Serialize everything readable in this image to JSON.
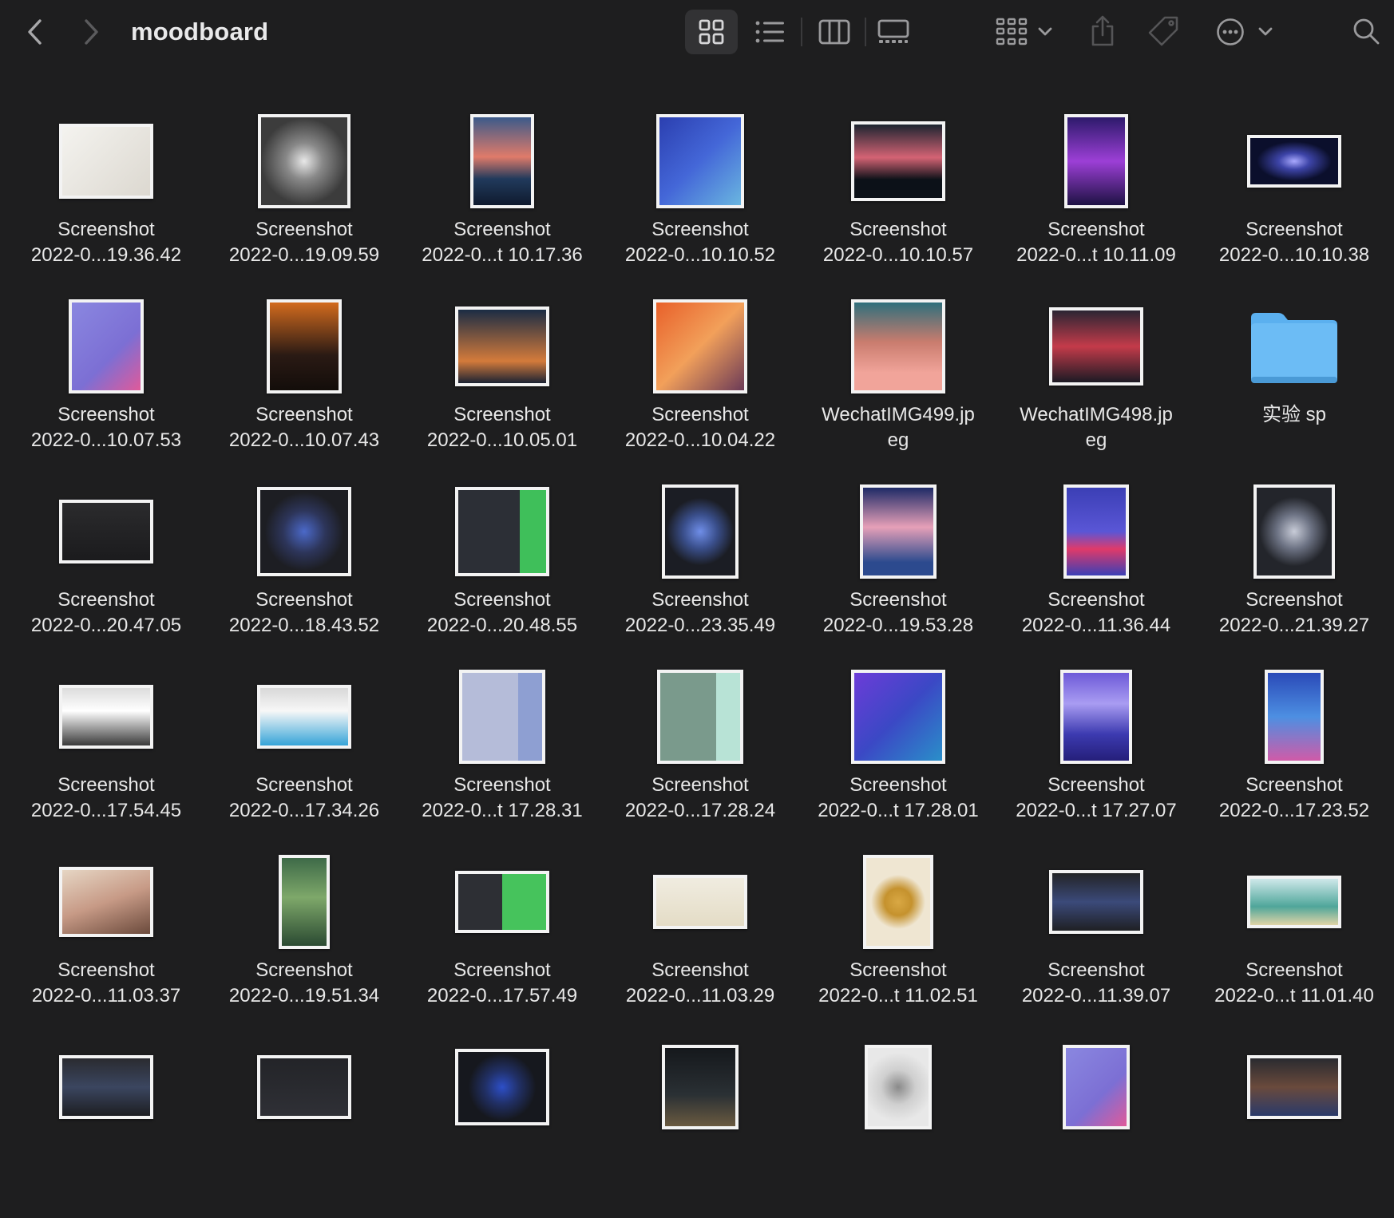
{
  "window": {
    "title": "moodboard"
  },
  "toolbar": {
    "back_icon": "chevron-left-icon",
    "forward_icon": "chevron-right-icon",
    "views": [
      "icon-view-icon",
      "list-view-icon",
      "column-view-icon",
      "gallery-view-icon"
    ],
    "active_view": "icon-view-icon",
    "group_icon": "group-by-icon",
    "share_icon": "share-icon",
    "tag_icon": "tag-icon",
    "more_icon": "ellipsis-circle-icon",
    "search_icon": "search-icon"
  },
  "colors": {
    "background": "#1e1e1f",
    "folder": "#5bb0ef",
    "selected_view_bg": "#323234"
  },
  "items": [
    {
      "l1": "Screenshot",
      "l2": "2022-0...19.36.42",
      "bg": "linear-gradient(135deg,#f4f3ef,#dcd8d0)",
      "w": 118,
      "h": 94
    },
    {
      "l1": "Screenshot",
      "l2": "2022-0...19.09.59",
      "bg": "radial-gradient(circle,#e8e8e8 0%,#888 30%,#3c3c3c 70%)",
      "w": 116,
      "h": 118
    },
    {
      "l1": "Screenshot",
      "l2": "2022-0...t 10.17.36",
      "bg": "linear-gradient(180deg,#3b5a8a 0%,#e07b6a 45%,#213a5c 70%,#0f1a2e)",
      "w": 80,
      "h": 118
    },
    {
      "l1": "Screenshot",
      "l2": "2022-0...10.10.52",
      "bg": "linear-gradient(135deg,#2b3fb0,#4467d8 50%,#6ab6e0)",
      "w": 110,
      "h": 118
    },
    {
      "l1": "Screenshot",
      "l2": "2022-0...10.10.57",
      "bg": "linear-gradient(180deg,#1c2430 0%,#d46374 45%,#0c1118 75%)",
      "w": 118,
      "h": 100
    },
    {
      "l1": "Screenshot",
      "l2": "2022-0...t 10.11.09",
      "bg": "linear-gradient(180deg,#2d1a6b,#9c3fd6 50%,#1e1244)",
      "w": 80,
      "h": 118
    },
    {
      "l1": "Screenshot",
      "l2": "2022-0...10.10.38",
      "bg": "radial-gradient(ellipse at center,#a9a9ff 0%,#3d44a8 25%,#0b0f2c 60%)",
      "w": 118,
      "h": 66
    },
    {
      "l1": "Screenshot",
      "l2": "2022-0...10.07.53",
      "bg": "linear-gradient(135deg,#8a87e0,#7c6fd4 60%,#e05a9a)",
      "w": 94,
      "h": 118
    },
    {
      "l1": "Screenshot",
      "l2": "2022-0...10.07.43",
      "bg": "linear-gradient(180deg,#d26b1e,#2a1a14 60%,#130d0a)",
      "w": 94,
      "h": 118
    },
    {
      "l1": "Screenshot",
      "l2": "2022-0...10.05.01",
      "bg": "linear-gradient(180deg,#1b2c44,#d47b3b 70%,#1b2233)",
      "w": 118,
      "h": 100
    },
    {
      "l1": "Screenshot",
      "l2": "2022-0...10.04.22",
      "bg": "linear-gradient(135deg,#e8602a,#f2a05a 50%,#6b3a57)",
      "w": 118,
      "h": 118
    },
    {
      "l1": "WechatIMG499.jp",
      "l2": "eg",
      "bg": "linear-gradient(180deg,#2f6f7c,#c97c6e 45%,#f1a49a 80%)",
      "w": 118,
      "h": 118
    },
    {
      "l1": "WechatIMG498.jp",
      "l2": "eg",
      "bg": "linear-gradient(180deg,#2b2533,#c43b4a 50%,#1c1a24)",
      "w": 118,
      "h": 98
    },
    {
      "l1": "实验 sp",
      "l2": "",
      "folder": true
    },
    {
      "l1": "Screenshot",
      "l2": "2022-0...20.47.05",
      "bg": "linear-gradient(180deg,#2b2b2d,#1b1b1d)",
      "w": 118,
      "h": 80
    },
    {
      "l1": "Screenshot",
      "l2": "2022-0...18.43.52",
      "bg": "radial-gradient(circle,#4b69c9 0%,#2d355a 35%,#1d1e23 65%)",
      "w": 118,
      "h": 112
    },
    {
      "l1": "Screenshot",
      "l2": "2022-0...20.48.55",
      "bg": "linear-gradient(90deg,#2c2f36 70%,#3fbf5a 70%)",
      "w": 118,
      "h": 112
    },
    {
      "l1": "Screenshot",
      "l2": "2022-0...23.35.49",
      "bg": "radial-gradient(circle,#6f8ee8 0%,#3a4f8c 30%,#1b1d24 60%)",
      "w": 96,
      "h": 118
    },
    {
      "l1": "Screenshot",
      "l2": "2022-0...19.53.28",
      "bg": "linear-gradient(180deg,#1e2a66,#e6a0b8 45%,#2c4a8e 85%)",
      "w": 96,
      "h": 118
    },
    {
      "l1": "Screenshot",
      "l2": "2022-0...11.36.44",
      "bg": "linear-gradient(180deg,#3b3fb5,#5a56d6 50%,#e03a6a 70%,#3b3fb5)",
      "w": 82,
      "h": 118
    },
    {
      "l1": "Screenshot",
      "l2": "2022-0...21.39.27",
      "bg": "radial-gradient(circle,#c8ccd8 0%,#6c7283 30%,#23252b 60%)",
      "w": 102,
      "h": 118
    },
    {
      "l1": "Screenshot",
      "l2": "2022-0...17.54.45",
      "bg": "linear-gradient(180deg,#dcdcdc,#ffffff 40%,#3a3a3a)",
      "w": 118,
      "h": 80
    },
    {
      "l1": "Screenshot",
      "l2": "2022-0...17.34.26",
      "bg": "linear-gradient(180deg,#d8d8d8,#f7f7f7 40%,#36a4d8)",
      "w": 118,
      "h": 80
    },
    {
      "l1": "Screenshot",
      "l2": "2022-0...t 17.28.31",
      "bg": "linear-gradient(90deg,#b5bcd9 70%,#8e9fd2 70%)",
      "w": 108,
      "h": 118
    },
    {
      "l1": "Screenshot",
      "l2": "2022-0...17.28.24",
      "bg": "linear-gradient(90deg,#7a9a8c 70%,#b8e3d6 70%)",
      "w": 108,
      "h": 118
    },
    {
      "l1": "Screenshot",
      "l2": "2022-0...t 17.28.01",
      "bg": "linear-gradient(135deg,#6c3cd8,#3b48c5 50%,#2a8fc9)",
      "w": 118,
      "h": 118
    },
    {
      "l1": "Screenshot",
      "l2": "2022-0...t 17.27.07",
      "bg": "linear-gradient(180deg,#6d5ad8,#a99cf2 35%,#3c3ab0 70%,#251f7a)",
      "w": 90,
      "h": 118
    },
    {
      "l1": "Screenshot",
      "l2": "2022-0...17.23.52",
      "bg": "linear-gradient(180deg,#2a4ab8,#4d8fe2 50%,#d05ba8)",
      "w": 74,
      "h": 118
    },
    {
      "l1": "Screenshot",
      "l2": "2022-0...11.03.37",
      "bg": "linear-gradient(160deg,#e6d6c4,#c79a86 50%,#6b4a3c)",
      "w": 118,
      "h": 88
    },
    {
      "l1": "Screenshot",
      "l2": "2022-0...19.51.34",
      "bg": "linear-gradient(180deg,#3e6a48,#7ea86a 45%,#2b4a32)",
      "w": 64,
      "h": 118
    },
    {
      "l1": "Screenshot",
      "l2": "2022-0...17.57.49",
      "bg": "linear-gradient(90deg,#2d2f34 50%,#46c35c 50%)",
      "w": 118,
      "h": 78
    },
    {
      "l1": "Screenshot",
      "l2": "2022-0...11.03.29",
      "bg": "linear-gradient(180deg,#f0ece0,#e4dcc6)",
      "w": 118,
      "h": 68
    },
    {
      "l1": "Screenshot",
      "l2": "2022-0...t 11.02.51",
      "bg": "radial-gradient(circle,#d9a844 0%,#c5922e 25%,#efe6d2 50%)",
      "w": 88,
      "h": 118
    },
    {
      "l1": "Screenshot",
      "l2": "2022-0...11.39.07",
      "bg": "linear-gradient(180deg,#232427,#3b4a7a 50%,#1f2024)",
      "w": 118,
      "h": 80
    },
    {
      "l1": "Screenshot",
      "l2": "2022-0...t 11.01.40",
      "bg": "linear-gradient(180deg,#cfe8ea,#4fa69a 60%,#e0d4a6)",
      "w": 118,
      "h": 66
    },
    {
      "l1": "",
      "l2": "",
      "bg": "linear-gradient(180deg,#2a2b30,#3b4660 50%,#1d1e22)",
      "w": 118,
      "h": 80
    },
    {
      "l1": "",
      "l2": "",
      "bg": "linear-gradient(180deg,#232428,#2f3036)",
      "w": 118,
      "h": 80
    },
    {
      "l1": "",
      "l2": "",
      "bg": "radial-gradient(circle,#2d4fc8 0%,#213066 30%,#16181e 60%)",
      "w": 118,
      "h": 96
    },
    {
      "l1": "",
      "l2": "",
      "bg": "linear-gradient(180deg,#15181c,#2a3034 60%,#6a5a40)",
      "w": 96,
      "h": 106
    },
    {
      "l1": "",
      "l2": "",
      "bg": "radial-gradient(circle,#8a8a8a 0%,#cfcfcf 35%,#e8e8e8 70%)",
      "w": 84,
      "h": 106
    },
    {
      "l1": "",
      "l2": "",
      "bg": "linear-gradient(135deg,#8a87e0,#7c6fd4 60%,#e05a9a)",
      "w": 84,
      "h": 106
    },
    {
      "l1": "",
      "l2": "",
      "bg": "linear-gradient(180deg,#2a2b30,#6a4a3c 50%,#2a3a6a)",
      "w": 118,
      "h": 80
    }
  ]
}
